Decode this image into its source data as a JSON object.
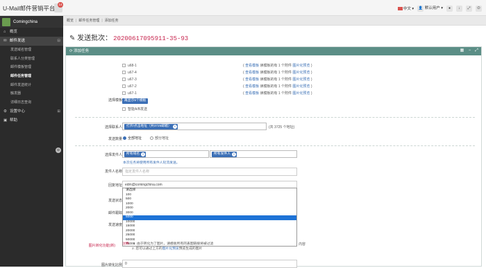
{
  "topbar": {
    "brand": "U-Mail邮件营销平台",
    "notification_count": "14",
    "language": "中文",
    "user_label": "默认用户"
  },
  "sidebar": {
    "username": "Comingchina",
    "items": [
      {
        "icon": "home-icon",
        "label": "概览"
      },
      {
        "icon": "envelope-icon",
        "label": "邮件发送",
        "expander": "⊟"
      },
      {
        "icon": "gear-icon",
        "label": "设置中心",
        "expander": "⊞"
      },
      {
        "icon": "help-icon",
        "label": "帮助"
      }
    ],
    "subitems": [
      "发送域名管理",
      "联系人分类管理",
      "邮件模板管理",
      "邮件任务管理",
      "邮件发送统计",
      "触发器",
      "详细日志查询"
    ],
    "collapse_icon": "⊖"
  },
  "breadcrumb": [
    "概览",
    "邮件任务管理",
    "添加任务"
  ],
  "page": {
    "title_prefix": "发送批次：",
    "batch_id": "20200617095911-35-93"
  },
  "panel": {
    "title": "添加任务",
    "labels": {
      "template": "选择模板",
      "contacts": "选择联系人",
      "send_count": "发送数量",
      "sender": "选择发件人",
      "sender_name": "发件人名称",
      "reply_to": "回复地址",
      "send_status": "发送状态",
      "tracking": "邮件跟踪",
      "speed": "发送速度",
      "img_convert": "图片转化功能(新)",
      "img_ratio": "图片转化比例"
    },
    "templates": [
      {
        "name": "u68-1",
        "info": "读模板的有 1 个附件"
      },
      {
        "name": "u67-4",
        "info": "读模板的有 1 个附件"
      },
      {
        "name": "u67-3",
        "info": "读模板的有 1 个附件"
      },
      {
        "name": "u67-2",
        "info": "读模板的有 1 个附件"
      },
      {
        "name": "u67-1",
        "info": "读模板的有 1 个附件"
      }
    ],
    "view_template": "查看模板",
    "img_preview": "图片化预览",
    "more_templates": "再显示5个模板",
    "ab_send": "智能A/B发送",
    "contacts_tag": "打开/点击地址（共3725邮箱）",
    "contacts_count": "(共 3725 个地址)",
    "send_all": "全部地址",
    "send_partial": "部分地址",
    "sender_domain_tag": "所有域名",
    "sender_tag": "所有发件人",
    "sender_note": "本次任务将使用所有发件人轮流发送。",
    "sender_name_placeholder": "指定发件人名称",
    "reply_to_value": "edm@comingchina.com",
    "speed_options": [
      "请选择",
      "100",
      "500",
      "1000",
      "2000",
      "3000",
      "5000",
      "10000",
      "15000",
      "20000",
      "25000",
      "50000",
      "75000"
    ],
    "speed_selected": "5000",
    "note_label": "注释：",
    "note_1": "1. 由于转化为了图片，请模板所有的表图链接将被过滤",
    "note_2_pre": "2. 您可以通过上方的",
    "note_2_link": "图片化预览",
    "note_2_post": "预览生成的图片",
    "note_right": "内容",
    "img_ratio_value": "0"
  }
}
